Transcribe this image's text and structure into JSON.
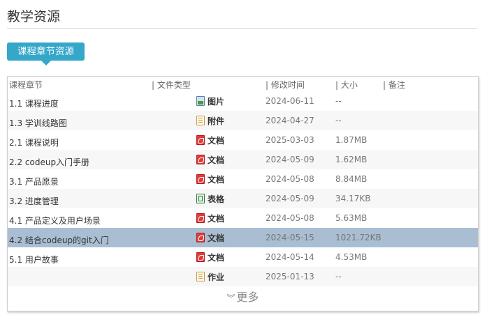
{
  "page": {
    "title": "教学资源"
  },
  "tag": {
    "label": "课程章节资源"
  },
  "table": {
    "headers": {
      "name": "课程章节",
      "type": "| 文件类型",
      "time": "| 修改时间",
      "size": "| 大小",
      "note": "| 备注"
    },
    "rows": [
      {
        "name": "1.1 课程进度",
        "icon": "image-icon",
        "type": "图片",
        "time": "2024-06-11",
        "size": "--"
      },
      {
        "name": "1.3 学训线路图",
        "icon": "document-icon",
        "type": "附件",
        "time": "2024-04-27",
        "size": "--"
      },
      {
        "name": "2.1 课程说明",
        "icon": "pdf-icon",
        "type": "文档",
        "time": "2025-03-03",
        "size": "1.87MB"
      },
      {
        "name": "2.2 codeup入门手册",
        "icon": "pdf-icon",
        "type": "文档",
        "time": "2024-05-09",
        "size": "1.62MB"
      },
      {
        "name": "3.1 产品愿景",
        "icon": "pdf-icon",
        "type": "文档",
        "time": "2024-05-08",
        "size": "8.84MB"
      },
      {
        "name": "3.2 进度管理",
        "icon": "spreadsheet-icon",
        "type": "表格",
        "time": "2024-05-09",
        "size": "34.17KB"
      },
      {
        "name": "4.1 产品定义及用户场景",
        "icon": "pdf-icon",
        "type": "文档",
        "time": "2024-05-08",
        "size": "5.63MB"
      },
      {
        "name": "4.2 结合codeup的git入门",
        "icon": "pdf-icon",
        "type": "文档",
        "time": "2024-05-15",
        "size": "1021.72KB",
        "selected": true
      },
      {
        "name": "5.1 用户故事",
        "icon": "pdf-icon",
        "type": "文档",
        "time": "2024-05-14",
        "size": "4.53MB"
      },
      {
        "name": "",
        "icon": "document-icon",
        "type": "作业",
        "time": "2025-01-13",
        "size": "--"
      }
    ]
  },
  "more": {
    "label": "更多",
    "icon": "double-chevron-down-icon"
  },
  "colors": {
    "accent": "#35a7c9",
    "selected_row": "#a9bed3",
    "pdf": "#e23b3b"
  }
}
